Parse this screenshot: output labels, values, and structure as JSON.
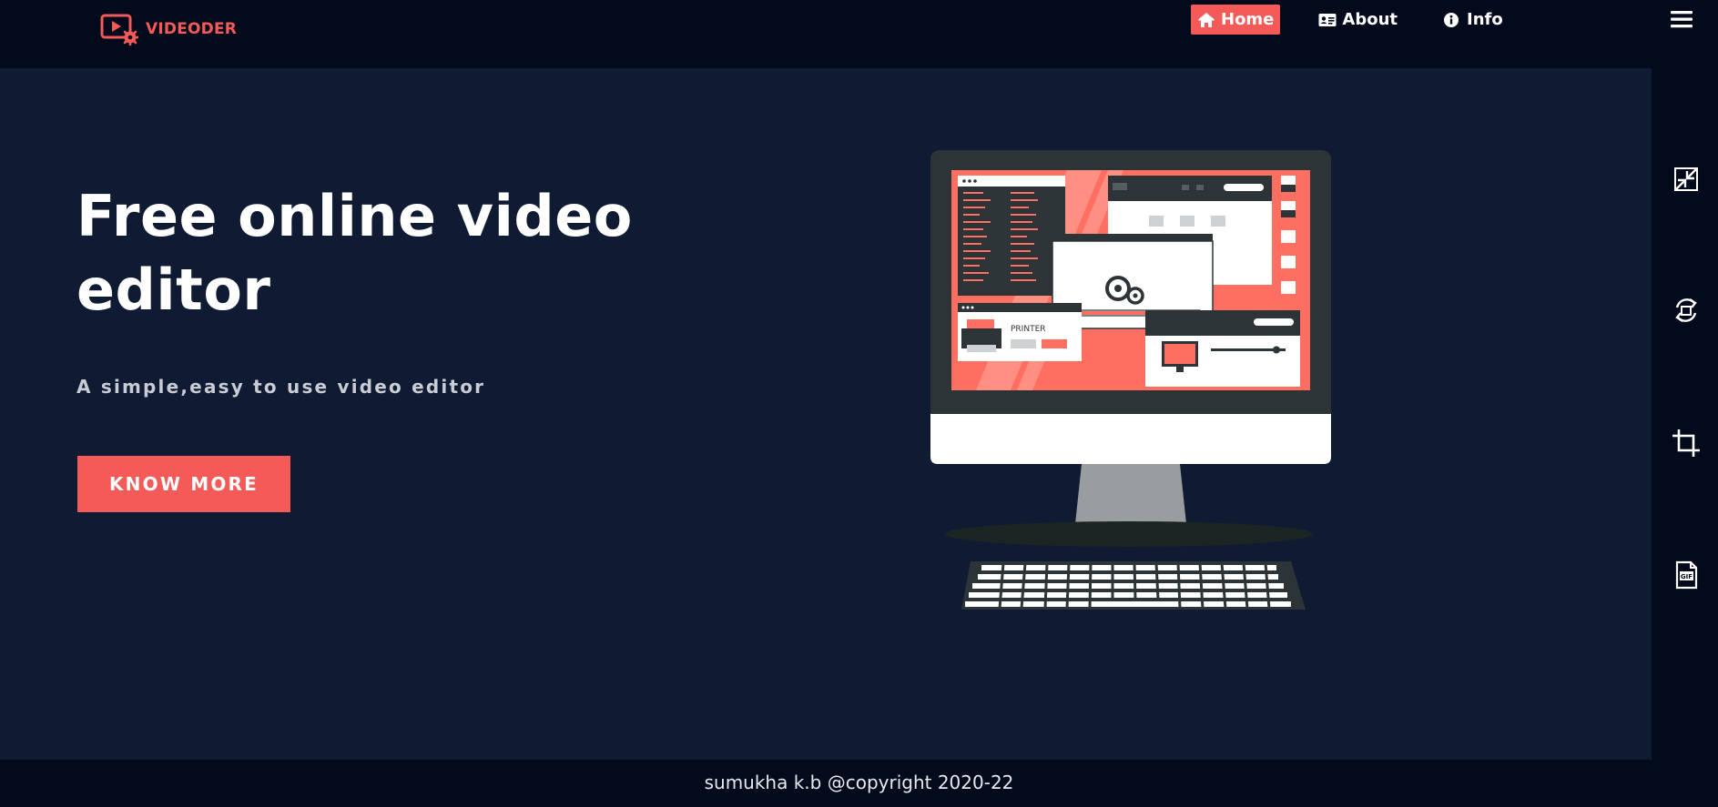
{
  "brand": {
    "name": "VIDEODER",
    "icon": "video-settings-icon",
    "color": "#f35a58"
  },
  "nav": {
    "items": [
      {
        "label": "Home",
        "icon": "home-icon",
        "active": true
      },
      {
        "label": "About",
        "icon": "id-card-icon",
        "active": false
      },
      {
        "label": "Info",
        "icon": "info-circle-icon",
        "active": false
      }
    ],
    "menu_icon": "hamburger-menu-icon"
  },
  "hero": {
    "title": "Free online video editor",
    "subtitle": "A simple,easy to use video editor",
    "button_label": "KNOW MORE",
    "illustration": "desktop-computer-illustration"
  },
  "sidebar": {
    "tools": [
      {
        "icon": "compress-icon"
      },
      {
        "icon": "rotate-icon"
      },
      {
        "icon": "crop-icon"
      },
      {
        "icon": "gif-file-icon"
      }
    ]
  },
  "footer": {
    "text": "sumukha k.b @copyright 2020-22"
  },
  "colors": {
    "accent": "#f35a58",
    "background": "#0f1a33",
    "header_bg": "#020a1c"
  }
}
